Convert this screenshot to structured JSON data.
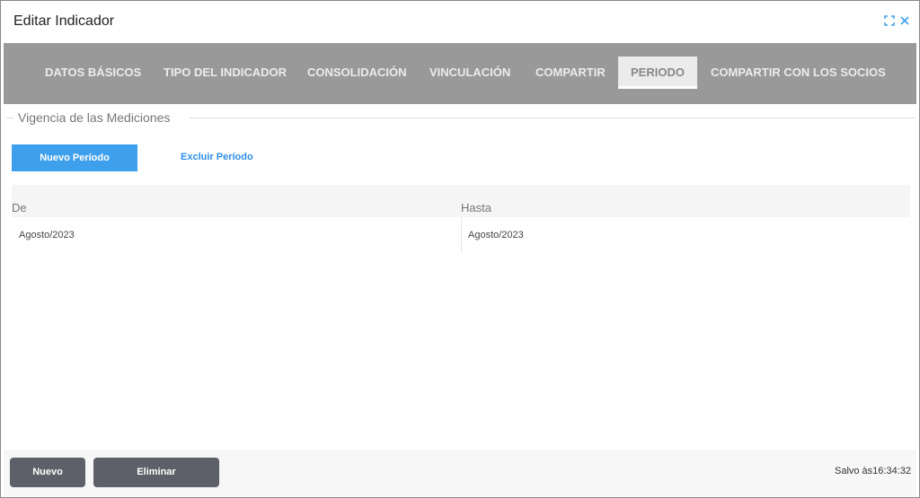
{
  "dialog": {
    "title": "Editar Indicador",
    "icons": [
      "expand-icon",
      "close-icon"
    ],
    "accent_color": "#3ea0ec"
  },
  "tabs": [
    {
      "label": "DATOS BÁSICOS",
      "active": false
    },
    {
      "label": "TIPO DEL INDICADOR",
      "active": false
    },
    {
      "label": "CONSOLIDACIÓN",
      "active": false
    },
    {
      "label": "VINCULACIÓN",
      "active": false
    },
    {
      "label": "COMPARTIR",
      "active": false
    },
    {
      "label": "PERIODO",
      "active": true
    },
    {
      "label": "COMPARTIR CON LOS SOCIOS",
      "active": false
    }
  ],
  "section": {
    "legend": "Vigencia de las Mediciones",
    "new_period_label": "Nuevo Período",
    "exclude_period_label": "Excluir Período"
  },
  "table": {
    "columns": [
      "De",
      "Hasta"
    ],
    "rows": [
      [
        "Agosto/2023",
        "Agosto/2023"
      ]
    ]
  },
  "footer": {
    "new_label": "Nuevo",
    "delete_label": "Eliminar",
    "saved_text": "Salvo às16:34:32"
  }
}
